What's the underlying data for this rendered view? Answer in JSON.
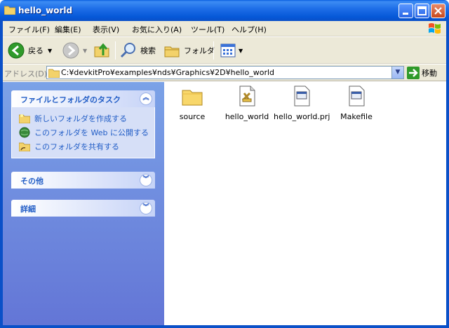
{
  "window": {
    "title": "hello_world",
    "buttons": {
      "minimize": "_",
      "maximize": "□",
      "close": "×"
    }
  },
  "menu": [
    "ファイル(F)",
    "編集(E)",
    "表示(V)",
    "お気に入り(A)",
    "ツール(T)",
    "ヘルプ(H)"
  ],
  "toolbar": {
    "back_label": "戻る",
    "search_label": "検索",
    "folders_label": "フォルダ"
  },
  "address": {
    "label": "アドレス(D)",
    "value": "C:¥devkitPro¥examples¥nds¥Graphics¥2D¥hello_world",
    "go_label": "移動"
  },
  "tasks": {
    "file_folder": {
      "title": "ファイルとフォルダのタスク",
      "items": [
        "新しいフォルダを作成する",
        "このフォルダを Web に公開する",
        "このフォルダを共有する"
      ]
    },
    "other": {
      "title": "その他"
    },
    "details": {
      "title": "詳細"
    }
  },
  "files": [
    {
      "name": "source",
      "type": "folder"
    },
    {
      "name": "hello_world",
      "type": "file-nds"
    },
    {
      "name": "hello_world.prj",
      "type": "file-doc"
    },
    {
      "name": "Makefile",
      "type": "file-doc"
    }
  ],
  "colors": {
    "accent": "#215dc6",
    "titlebar": "#0a5fe0"
  }
}
